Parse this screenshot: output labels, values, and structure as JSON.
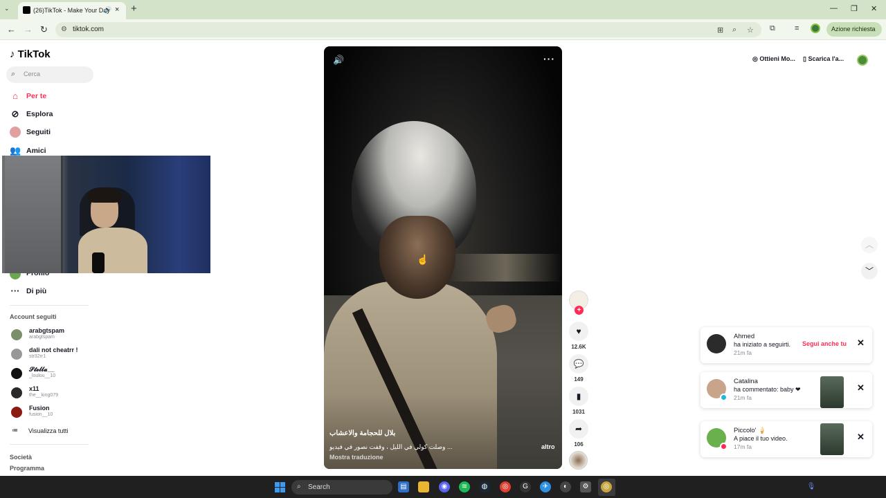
{
  "browser": {
    "tab_title": "(26)TikTok - Make Your Day",
    "url": "tiktok.com",
    "action_button": "Azione richiesta"
  },
  "sidebar": {
    "logo": "TikTok",
    "search_placeholder": "Cerca",
    "nav": [
      {
        "label": "Per te",
        "icon": "home-icon"
      },
      {
        "label": "Esplora",
        "icon": "compass-icon"
      },
      {
        "label": "Seguiti",
        "icon": "following-icon"
      },
      {
        "label": "Amici",
        "icon": "friends-icon"
      },
      {
        "label": "Profilo",
        "icon": "profile-icon"
      },
      {
        "label": "Di più",
        "icon": "more-icon"
      }
    ],
    "following_header": "Account seguiti",
    "accounts": [
      {
        "name": "arabgtspam",
        "handle": "arabgtspam"
      },
      {
        "name": "dali not cheatrr !",
        "handle": "str32rr1"
      },
      {
        "name": "𝓢𝓽𝓮𝓵𝓵𝓪__",
        "handle": "_loulou__10"
      },
      {
        "name": "x11",
        "handle": "the__king079"
      },
      {
        "name": "Fusion",
        "handle": "fusion__10"
      }
    ],
    "view_all": "Visualizza tutti",
    "footer": [
      "Società",
      "Programma"
    ]
  },
  "video": {
    "author": "بلال للحجامة والاعشاب",
    "description": "... وصلت كولي في الليل ، وقفت نصور في فيديو",
    "more": "altro",
    "translate": "Mostra traduzione"
  },
  "actions": {
    "likes": "12.6K",
    "comments": "149",
    "saves": "1031",
    "shares": "106"
  },
  "topbar": {
    "get_coins": "Ottieni Mo...",
    "download": "Scarica l'a..."
  },
  "notifications": [
    {
      "name": "Ahmed",
      "message": "ha iniziato a seguirti.",
      "time": "21m fa",
      "action": "Segui anche tu"
    },
    {
      "name": "Catalina",
      "message": "ha commentato: baby ❤",
      "time": "21m fa"
    },
    {
      "name": "Piccolo' 🍦",
      "message": "A piace il tuo video.",
      "time": "17m fa"
    }
  ],
  "taskbar": {
    "search": "Search"
  },
  "colors": {
    "brand": "#fe2c55",
    "chrome_tabbar": "#d3e3c9"
  }
}
